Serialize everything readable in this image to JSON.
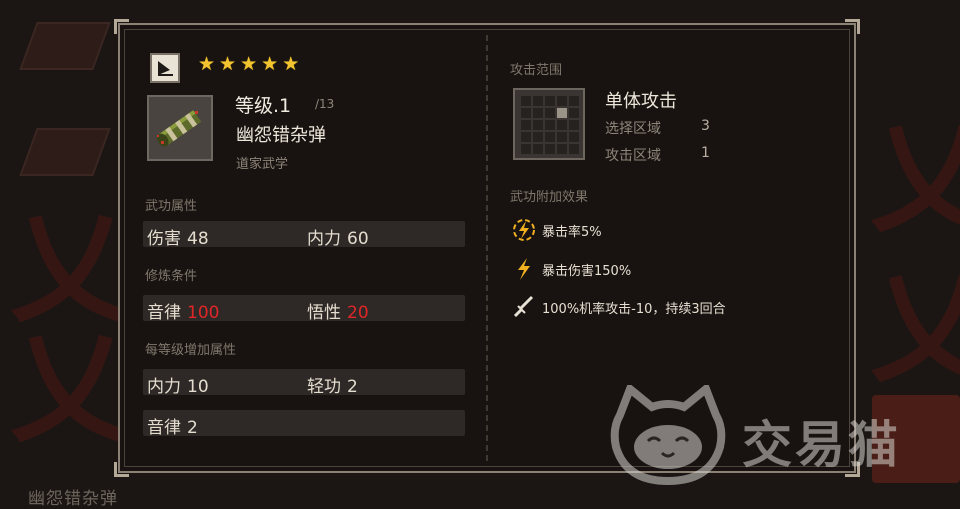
{
  "background": {
    "bottom_label": "幽怨错杂弹"
  },
  "header": {
    "type_icon": "flag-icon",
    "stars": 5
  },
  "item": {
    "icon": "scroll-icon",
    "level_label": "等级.1",
    "level_max": "/13",
    "name": "幽怨错杂弹",
    "school": "道家武学"
  },
  "attributes": {
    "title": "武功属性",
    "damage_label": "伤害",
    "damage_value": "48",
    "inner_label": "内力",
    "inner_value": "60"
  },
  "requirements": {
    "title": "修炼条件",
    "rhythm_label": "音律",
    "rhythm_value": "100",
    "insight_label": "悟性",
    "insight_value": "20",
    "value_color": "#e02626"
  },
  "per_level": {
    "title": "每等级增加属性",
    "inner_label": "内力",
    "inner_value": "10",
    "qinggong_label": "轻功",
    "qinggong_value": "2",
    "rhythm_label": "音律",
    "rhythm_value": "2"
  },
  "attack_range": {
    "title": "攻击范围",
    "type": "单体攻击",
    "select_label": "选择区域",
    "select_value": "3",
    "attack_label": "攻击区域",
    "attack_value": "1"
  },
  "extra_effects": {
    "title": "武功附加效果",
    "items": [
      {
        "icon": "crit-rate-icon",
        "text": "暴击率5%"
      },
      {
        "icon": "lightning-icon",
        "text": "暴击伤害150%"
      },
      {
        "icon": "sword-icon",
        "text": "100%机率攻击-10，持续3回合"
      }
    ]
  },
  "watermark": {
    "logo": "cat-logo-icon",
    "text": "交易猫"
  },
  "colors": {
    "star": "#f2c430",
    "effect_icon": "#f0b020",
    "panel_border": "#8b8275"
  }
}
